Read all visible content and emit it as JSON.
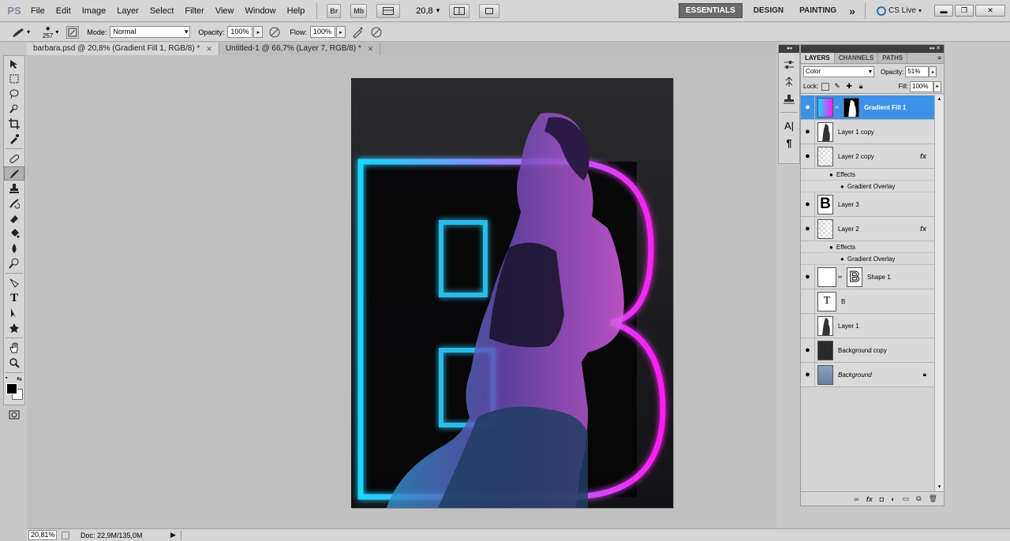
{
  "app": {
    "logo": "PS"
  },
  "menu": [
    "File",
    "Edit",
    "Image",
    "Layer",
    "Select",
    "Filter",
    "View",
    "Window",
    "Help"
  ],
  "appbar": {
    "bridge": "Br",
    "minibridge": "Mb",
    "zoom": "20,8",
    "zoom_arrow": "▾"
  },
  "workspaces": {
    "essentials": "ESSENTIALS",
    "design": "DESIGN",
    "painting": "PAINTING",
    "more": "»",
    "cs_live": "CS Live"
  },
  "window_buttons": {
    "min": "▬",
    "max": "❐",
    "close": "✕"
  },
  "options": {
    "brush_size": "257",
    "mode_label": "Mode:",
    "mode_value": "Normal",
    "opacity_label": "Opacity:",
    "opacity_value": "100%",
    "flow_label": "Flow:",
    "flow_value": "100%"
  },
  "tabs": [
    {
      "label": "barbara.psd @ 20,8% (Gradient Fill 1, RGB/8) *",
      "close": "✕"
    },
    {
      "label": "Untitled-1 @ 66,7% (Layer 7, RGB/8) *",
      "close": "✕"
    }
  ],
  "status": {
    "zoom": "20,81%",
    "doc": "Doc: 22,9M/135,0M",
    "arrow": "▶"
  },
  "panel": {
    "collapse": "◂◂",
    "tabs": [
      "LAYERS",
      "CHANNELS",
      "PATHS"
    ],
    "blend_mode": "Color",
    "opacity_label": "Opacity:",
    "opacity_value": "51%",
    "lock_label": "Lock:",
    "fill_label": "Fill:",
    "fill_value": "100%",
    "fx": "fx",
    "effects": "Effects",
    "gradient_overlay": "Gradient Overlay",
    "layers": [
      "Gradient Fill 1",
      "Layer 1 copy",
      "Layer 2 copy",
      "Layer 3",
      "Layer 2",
      "Shape 1",
      "B",
      "Layer 1",
      "Background copy",
      "Background"
    ]
  },
  "colors": {
    "neon_cyan": "#19d6ff",
    "neon_magenta": "#ff1cf0",
    "selection": "#3d91e6"
  }
}
